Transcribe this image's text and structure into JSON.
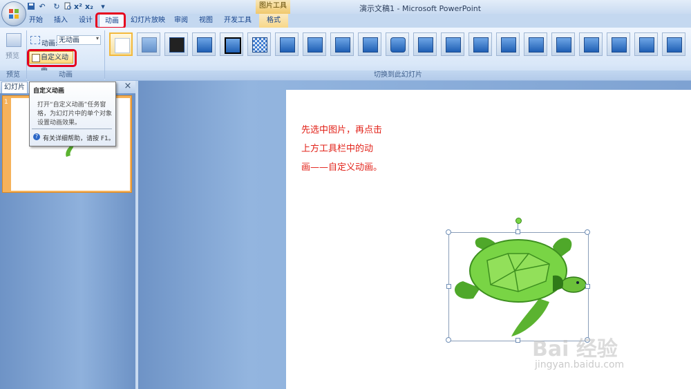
{
  "window": {
    "title": "演示文稿1 - Microsoft PowerPoint",
    "contextual_tab_group": "图片工具"
  },
  "quick_access": [
    "save-icon",
    "undo-icon",
    "redo-icon",
    "print-preview-icon",
    "superscript-icon",
    "subscript-icon",
    "customize-qat-icon"
  ],
  "quick_access_glyphs": {
    "superscript": "x²",
    "subscript": "x₂",
    "dropdown": "▾"
  },
  "tabs": [
    "开始",
    "插入",
    "设计",
    "动画",
    "幻灯片放映",
    "审阅",
    "视图",
    "开发工具",
    "格式"
  ],
  "active_tab": "动画",
  "ribbon": {
    "preview_group": {
      "button_label": "预览",
      "group_label": "预览"
    },
    "animation_group": {
      "animation_label": "动画:",
      "animation_value": "无动画",
      "custom_animation_button": "自定义动画",
      "group_label": "动画"
    },
    "transition_group": {
      "group_label": "切换到此幻灯片"
    }
  },
  "tooltip": {
    "title": "自定义动画",
    "body": "打开“自定义动画”任务窗格，为幻灯片中的单个对象设置动画效果。",
    "help": "有关详细帮助，请按 F1。"
  },
  "slides_pane": {
    "tab_label": "幻灯片",
    "close_glyph": "×",
    "slide_number": "1"
  },
  "slide": {
    "instruction_lines": [
      "先选中图片，再点击",
      "上方工具栏中的动",
      "画——自定义动画。"
    ]
  },
  "watermark": {
    "main": "Bai 经验",
    "sub": "jingyan.baidu.com"
  },
  "colors": {
    "annotation_red": "#e6001e",
    "instruction_text": "#e2231a",
    "turtle_green": "#6cc13a"
  }
}
